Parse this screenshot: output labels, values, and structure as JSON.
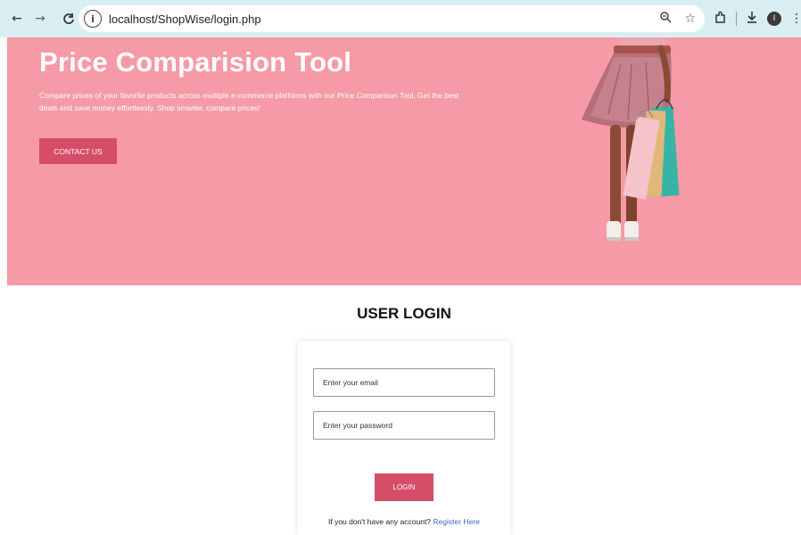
{
  "browser": {
    "url": "localhost/ShopWise/login.php",
    "icons": [
      "back-icon",
      "forward-icon",
      "reload-icon",
      "site-info-icon",
      "zoom-icon",
      "bookmark-star-icon",
      "extensions-icon",
      "downloads-icon",
      "profile-avatar",
      "menu-kebab-icon"
    ],
    "back_glyph": "←",
    "forward_glyph": "→",
    "reload_glyph": "C",
    "site_info_glyph": "i",
    "zoom_glyph": "⚲",
    "star_glyph": "☆",
    "extensions_glyph": "⧉",
    "downloads_glyph": "⤓",
    "profile_glyph": "I",
    "kebab_glyph": "⋮"
  },
  "hero": {
    "title": "Price Comparision Tool",
    "description": "Compare prices of your favorite products across multiple e-commerce platforms with our Price Comparison Tool. Get the best deals and save money effortlessly. Shop smarter, compare prices!",
    "contact_label": "CONTACT US",
    "background_color": "#f59aa6",
    "accent_color": "#d64d68"
  },
  "login": {
    "title": "USER LOGIN",
    "email_placeholder": "Enter your email",
    "password_placeholder": "Enter your password",
    "login_label": "LOGIN",
    "register_prompt": "If you don't have any account?",
    "register_link": "Register Here"
  }
}
